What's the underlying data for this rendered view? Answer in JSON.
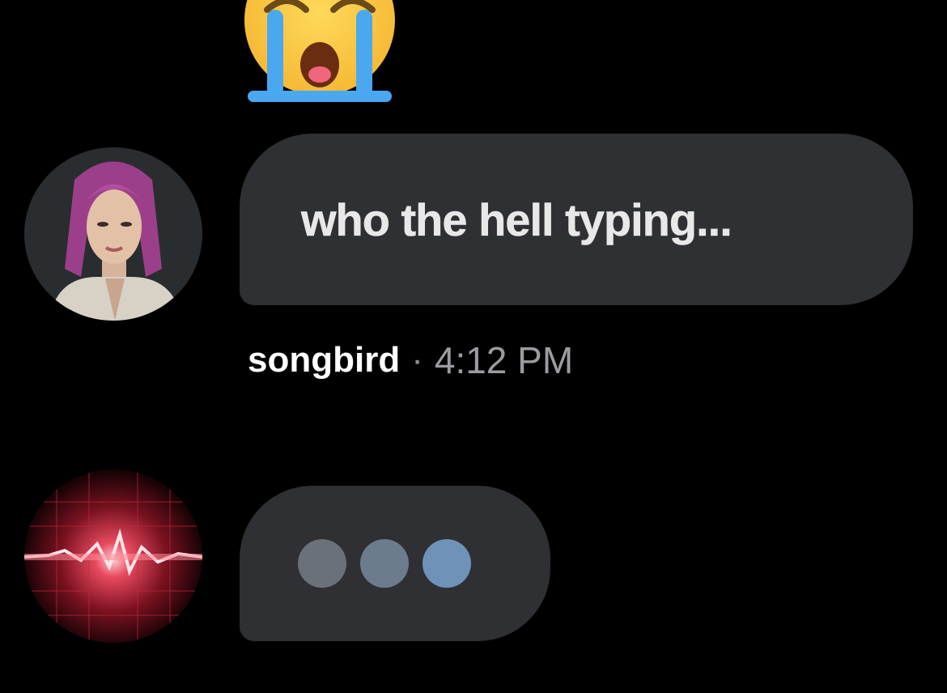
{
  "message": {
    "text": "who the hell typing...",
    "sender": "songbird",
    "separator": "·",
    "time": "4:12 PM"
  },
  "reaction": {
    "icon": "crying-face-emoji"
  },
  "typing_indicator": {
    "dot_count": 3,
    "dot_colors": [
      "#6b7178",
      "#6c7c8d",
      "#6f93b8"
    ]
  },
  "colors": {
    "background": "#000000",
    "bubble": "#2f3033",
    "message_text": "#e8e8e8",
    "sender_name": "#ffffff",
    "timestamp": "#9a9ca1"
  },
  "avatars": {
    "sender": "songbird-avatar",
    "typer": "red-signal-avatar"
  }
}
